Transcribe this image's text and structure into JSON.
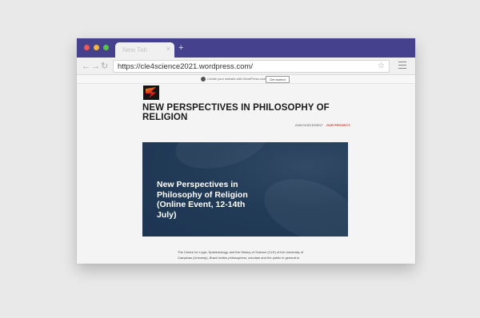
{
  "browser": {
    "tab_title": "New Tab",
    "tab_close": "×",
    "new_tab": "+",
    "url": "https://cle4science2021.wordpress.com/",
    "star": "☆",
    "back": "←",
    "forward": "→",
    "reload": "↻"
  },
  "wp_bar": {
    "text": "Create your website with WordPress.com",
    "button": "Get started"
  },
  "site": {
    "title": "NEW PERSPECTIVES IN PHILOSOPHY OF RELIGION",
    "menu": [
      "ANNOUNCEMENT",
      "OUR PROJECT"
    ]
  },
  "hero": {
    "lines": [
      "New Perspectives in",
      "Philosophy of Religion",
      "(Online Event, 12-14th",
      "July)"
    ]
  },
  "body": {
    "lines": [
      "The Centre for Logic, Epistemology, and the History of Science (CLE) of the University of",
      "Campinas (Unicamp), Brazil invites philosophers, scholars and the public in general to"
    ]
  },
  "colors": {
    "titlebar": "#45418c",
    "hero": "#223b57",
    "accent": "#c0392b"
  }
}
